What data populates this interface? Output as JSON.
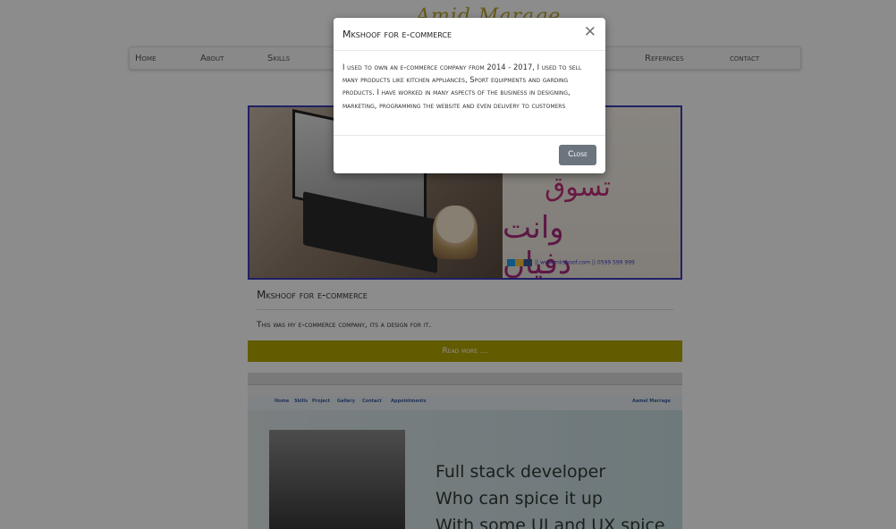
{
  "site": {
    "logo_text": "Amid Marage"
  },
  "nav": {
    "items": [
      "Home",
      "About",
      "Skills",
      "Refernces",
      "contact"
    ]
  },
  "cards": [
    {
      "title": "Mkshoof for e-commerce",
      "description": "This was my e-commerce company, its a design for it.",
      "button": "Read more ...",
      "image_text": {
        "line1": "تسوق",
        "line2": "وانت دفيان",
        "footer": "|| www.mkshoof.com || 0599 599 999"
      }
    },
    {
      "hero_lines": [
        "Full stack developer",
        "Who can spice it up",
        "With some UI and UX spice"
      ],
      "site_nav": [
        "Home",
        "Skills",
        "Project",
        "Gallery",
        "Contact",
        "Appointments",
        "Aamel Marrage"
      ]
    }
  ],
  "modal": {
    "title": "Mkshoof for e-commerce",
    "body": "I used to own an e-commerce company from 2014 - 2017, I used to sell many products like kitchen appliances, Sport equipments and garding products. I have worked in many aspects of the business in designing, marketing, programming the website and even delivery to customers",
    "close_label": "Close"
  }
}
